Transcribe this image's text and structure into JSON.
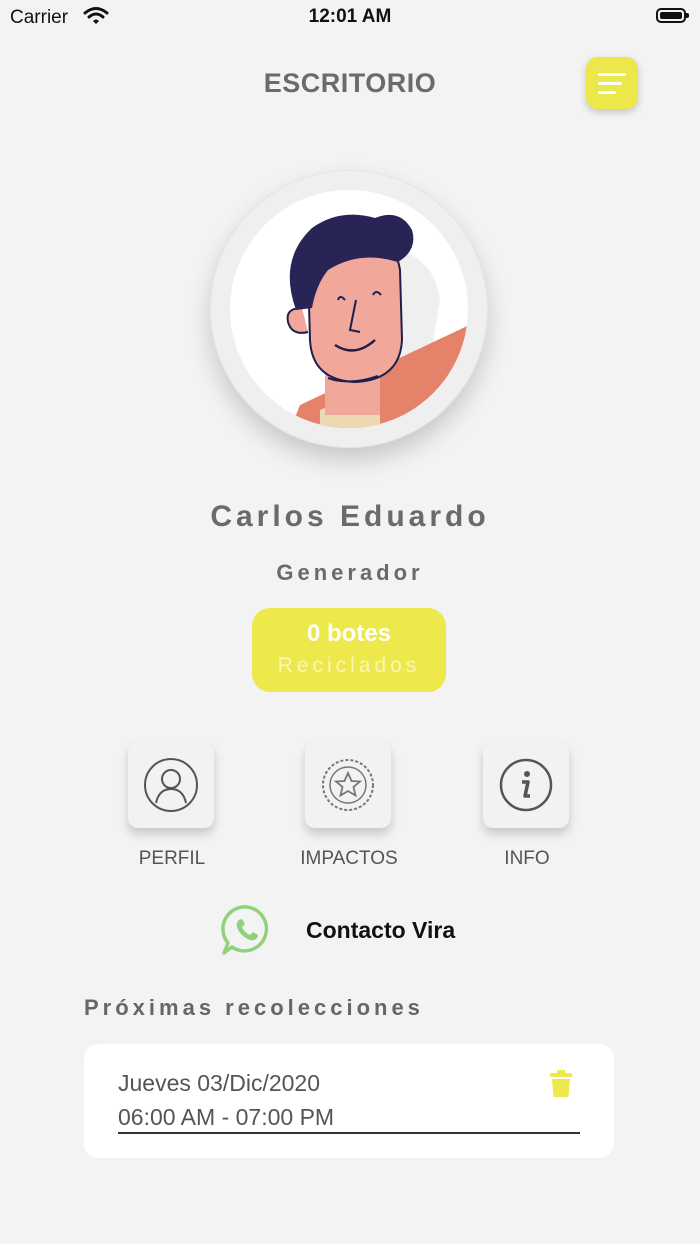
{
  "status_bar": {
    "carrier": "Carrier",
    "time": "12:01 AM"
  },
  "header": {
    "title": "ESCRITORIO",
    "menu_icon": "hamburger-menu-icon"
  },
  "profile": {
    "name": "Carlos Eduardo",
    "role": "Generador",
    "recycled_count": "0 botes",
    "recycled_label": "Reciclados"
  },
  "actions": [
    {
      "label": "PERFIL",
      "icon": "user-icon"
    },
    {
      "label": "IMPACTOS",
      "icon": "star-badge-icon"
    },
    {
      "label": "INFO",
      "icon": "info-icon"
    }
  ],
  "contact": {
    "label": "Contacto Vira",
    "icon": "whatsapp-icon"
  },
  "upcoming": {
    "title": "Próximas recolecciones",
    "items": [
      {
        "date": "Jueves 03/Dic/2020",
        "time": "06:00 AM - 07:00 PM",
        "icon": "trash-icon"
      }
    ]
  },
  "colors": {
    "accent": "#ede84c",
    "text": "#6a6a6a",
    "background": "#f3f3f3",
    "whatsapp": "#8fd27a"
  }
}
